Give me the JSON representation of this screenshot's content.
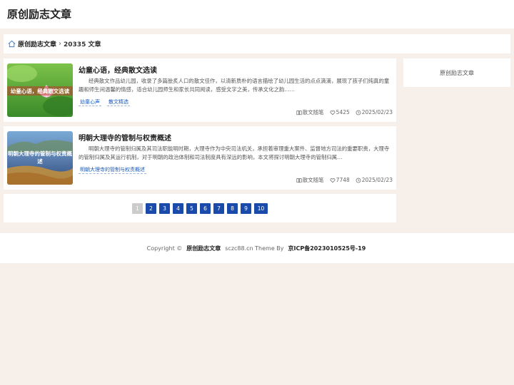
{
  "header": {
    "site_title": "原创励志文章"
  },
  "breadcrumb": {
    "home": "原创励志文章",
    "count": "20335 文章"
  },
  "articles": [
    {
      "title": "幼童心语，经典散文选读",
      "thumb_text": "幼童心语，经典散文选读",
      "excerpt": "经典散文作品幼儿园，收录了多篇脍炙人口的散文佳作，以清新质朴的语言描绘了幼儿园生活的点点滴滴，展现了孩子们纯真的童趣和师生间温馨的情感，适合幼儿园师生和家长共同阅读，感受文字之美，传承文化之韵……",
      "tags": [
        "幼童心声",
        "散文精选"
      ],
      "category": "散文随笔",
      "likes": "5425",
      "date": "2025/02/23"
    },
    {
      "title": "明朝大理寺的管制与权责概述",
      "thumb_text": "明朝大理寺的管制与权责概述",
      "excerpt": "明朝大理寺的管制归属及其司法职能明时期，大理寺作为中央司法机关，承担着审理重大案件、监督地方司法的重要职责，大理寺的管制归属及其运行机制，对于明朝的政治体制和司法制度具有深远的影响，本文将探讨明朝大理寺的管制归属…",
      "tags": [
        "明朝大理寺的管制与权责概述"
      ],
      "category": "散文随笔",
      "likes": "7748",
      "date": "2025/02/23"
    }
  ],
  "pagination": {
    "pages": [
      "1",
      "2",
      "3",
      "4",
      "5",
      "6",
      "7",
      "8",
      "9",
      "10"
    ],
    "current": "1"
  },
  "sidebar": {
    "text": "原创励志文章"
  },
  "footer": {
    "copyright": "Copyright ©",
    "site": "原创励志文章",
    "theme": "sczc88.cn Theme By",
    "icp": "京ICP备2023010525号-19"
  },
  "colors": {
    "page_accent": "#1a4aaa",
    "tag_link": "#1a5ab8"
  }
}
